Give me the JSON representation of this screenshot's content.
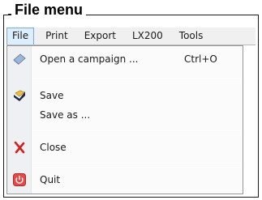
{
  "caption": "File menu",
  "menubar": {
    "items": [
      {
        "label": "File"
      },
      {
        "label": "Print"
      },
      {
        "label": "Export"
      },
      {
        "label": "LX200"
      },
      {
        "label": "Tools"
      }
    ]
  },
  "dropdown": {
    "items": [
      {
        "label": "Open a campaign ...",
        "shortcut": "Ctrl+O",
        "icon": "open-campaign-icon"
      },
      {
        "label": "Save",
        "icon": "save-icon"
      },
      {
        "label": "Save as ...",
        "icon": ""
      },
      {
        "label": "Close",
        "icon": "close-icon"
      },
      {
        "label": "Quit",
        "icon": "quit-icon"
      }
    ]
  },
  "colors": {
    "menu_highlight": "#ddeeff",
    "menu_highlight_border": "#7aa9dd",
    "close_red": "#d32020",
    "quit_red": "#e24a4a"
  }
}
